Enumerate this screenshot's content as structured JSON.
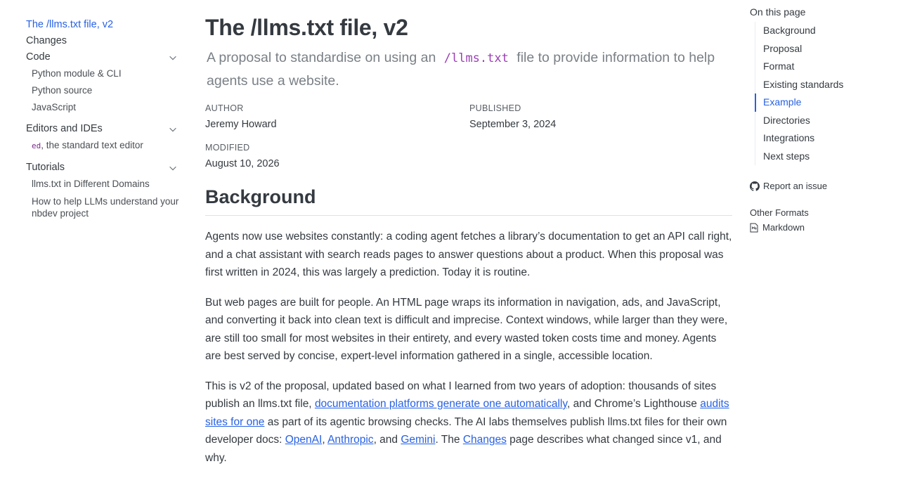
{
  "sidebar": {
    "top_links": [
      "The /llms.txt file, v2",
      "Changes"
    ],
    "sections": [
      {
        "label": "Code",
        "items": [
          "Python module & CLI",
          "Python source",
          "JavaScript"
        ]
      },
      {
        "label": "Editors and IDEs",
        "items": [
          {
            "code": "ed",
            "text": ", the standard text editor"
          }
        ]
      },
      {
        "label": "Tutorials",
        "items": [
          "llms.txt in Different Domains",
          "How to help LLMs understand your nbdev project"
        ]
      }
    ]
  },
  "main": {
    "title": "The /llms.txt file, v2",
    "subtitle_pre": "A proposal to standardise on using an",
    "subtitle_code": "/llms.txt",
    "subtitle_post": "file to provide information to help agents use a website.",
    "author_label": "AUTHOR",
    "author": "Jeremy Howard",
    "published_label": "PUBLISHED",
    "published": "September 3, 2024",
    "modified_label": "MODIFIED",
    "modified": "August 10, 2026",
    "section_heading": "Background",
    "p1": "Agents now use websites constantly: a coding agent fetches a library’s documentation to get an API call right, and a chat assistant with search reads pages to answer questions about a product. When this proposal was first written in 2024, this was largely a prediction. Today it is routine.",
    "p2": "But web pages are built for people. An HTML page wraps its information in navigation, ads, and JavaScript, and converting it back into clean text is difficult and imprecise. Context windows, while larger than they were, are still too small for most websites in their entirety, and every wasted token costs time and money. Agents are best served by concise, expert-level information gathered in a single, accessible location.",
    "p3": {
      "t1": "This is v2 of the proposal, updated based on what I learned from two years of adoption: thousands of sites publish an llms.txt file, ",
      "link1": "documentation platforms generate one automatically",
      "t2": ", and Chrome’s Lighthouse ",
      "link2": "audits sites for one",
      "t3": " as part of its agentic browsing checks. The AI labs themselves publish llms.txt files for their own developer docs: ",
      "link3": "OpenAI",
      "t4": ", ",
      "link4": "Anthropic",
      "t5": ", and ",
      "link5": "Gemini",
      "t6": ". The ",
      "link6": "Changes",
      "t7": " page describes what changed since v1, and why."
    }
  },
  "toc": {
    "title": "On this page",
    "items": [
      "Background",
      "Proposal",
      "Format",
      "Existing standards",
      "Example",
      "Directories",
      "Integrations",
      "Next steps"
    ],
    "active_index": 4,
    "report_issue": "Report an issue",
    "other_formats_title": "Other Formats",
    "markdown": "Markdown"
  },
  "colors": {
    "link": "#2761e3",
    "code": "#9a3fb4",
    "text": "#343a40",
    "muted": "#7a8086"
  }
}
